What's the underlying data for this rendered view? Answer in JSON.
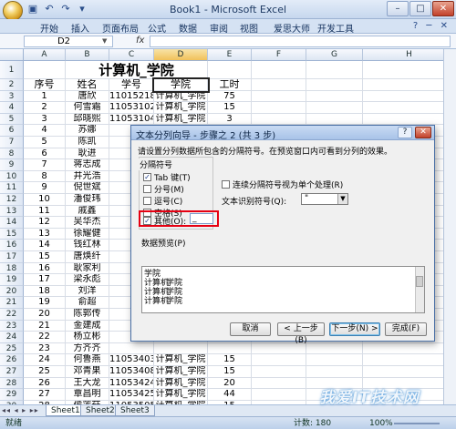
{
  "window": {
    "title": "Book1 - Microsoft Excel",
    "minimize": "–",
    "maximize": "□",
    "close": "✕"
  },
  "ribbon": {
    "tabs": [
      "开始",
      "插入",
      "页面布局",
      "公式",
      "数据",
      "审阅",
      "视图",
      "爱思大师",
      "开发工具"
    ],
    "right_icons": "? ─ ✕"
  },
  "formula_bar": {
    "name_box": "D2",
    "fx": "fx",
    "value": ""
  },
  "grid": {
    "columns": [
      "A",
      "B",
      "C",
      "D",
      "E",
      "F",
      "G",
      "H"
    ],
    "selected_column": "D",
    "rows": [
      {
        "n": "1",
        "cells": [
          "",
          "",
          "计算机_学院",
          "",
          "",
          "",
          "",
          ""
        ]
      },
      {
        "n": "2",
        "cells": [
          "序号",
          "姓名",
          "学号",
          "学院",
          "工时",
          "",
          "",
          ""
        ]
      },
      {
        "n": "3",
        "cells": [
          "1",
          "唐欣",
          "11015218",
          "计算机_学院",
          "75",
          "",
          "",
          ""
        ]
      },
      {
        "n": "4",
        "cells": [
          "2",
          "何雪霜",
          "11053102",
          "计算机_学院",
          "15",
          "",
          "",
          ""
        ]
      },
      {
        "n": "5",
        "cells": [
          "3",
          "邱晓熙",
          "11053104",
          "计算机_学院",
          "3",
          "",
          "",
          ""
        ]
      },
      {
        "n": "6",
        "cells": [
          "4",
          "苏娜",
          "",
          "",
          "",
          "",
          "",
          ""
        ]
      },
      {
        "n": "7",
        "cells": [
          "5",
          "陈凯",
          "",
          "",
          "",
          "",
          "",
          ""
        ]
      },
      {
        "n": "8",
        "cells": [
          "6",
          "耿进",
          "",
          "",
          "",
          "",
          "",
          ""
        ]
      },
      {
        "n": "9",
        "cells": [
          "7",
          "蒋志成",
          "",
          "",
          "",
          "",
          "",
          ""
        ]
      },
      {
        "n": "10",
        "cells": [
          "8",
          "井光浩",
          "",
          "",
          "",
          "",
          "",
          ""
        ]
      },
      {
        "n": "11",
        "cells": [
          "9",
          "倪世斌",
          "",
          "",
          "",
          "",
          "",
          ""
        ]
      },
      {
        "n": "12",
        "cells": [
          "10",
          "潘俊玮",
          "",
          "",
          "",
          "",
          "",
          ""
        ]
      },
      {
        "n": "13",
        "cells": [
          "11",
          "戚鑫",
          "",
          "",
          "",
          "",
          "",
          ""
        ]
      },
      {
        "n": "14",
        "cells": [
          "12",
          "吴华杰",
          "",
          "",
          "",
          "",
          "",
          ""
        ]
      },
      {
        "n": "15",
        "cells": [
          "13",
          "徐耀健",
          "",
          "",
          "",
          "",
          "",
          ""
        ]
      },
      {
        "n": "16",
        "cells": [
          "14",
          "钱红林",
          "",
          "",
          "",
          "",
          "",
          ""
        ]
      },
      {
        "n": "17",
        "cells": [
          "15",
          "唐焕纤",
          "",
          "",
          "",
          "",
          "",
          ""
        ]
      },
      {
        "n": "18",
        "cells": [
          "16",
          "耿家利",
          "",
          "",
          "",
          "",
          "",
          ""
        ]
      },
      {
        "n": "19",
        "cells": [
          "17",
          "梁永彪",
          "",
          "",
          "",
          "",
          "",
          ""
        ]
      },
      {
        "n": "20",
        "cells": [
          "18",
          "刘洋",
          "",
          "",
          "",
          "",
          "",
          ""
        ]
      },
      {
        "n": "21",
        "cells": [
          "19",
          "俞超",
          "",
          "",
          "",
          "",
          "",
          ""
        ]
      },
      {
        "n": "22",
        "cells": [
          "20",
          "陈郭传",
          "",
          "",
          "",
          "",
          "",
          ""
        ]
      },
      {
        "n": "23",
        "cells": [
          "21",
          "金建成",
          "",
          "",
          "",
          "",
          "",
          ""
        ]
      },
      {
        "n": "24",
        "cells": [
          "22",
          "杨立彬",
          "",
          "",
          "",
          "",
          "",
          ""
        ]
      },
      {
        "n": "25",
        "cells": [
          "23",
          "方齐齐",
          "",
          "",
          "",
          "",
          "",
          ""
        ]
      },
      {
        "n": "26",
        "cells": [
          "24",
          "何鲁燕",
          "11053403",
          "计算机_学院",
          "15",
          "",
          "",
          ""
        ]
      },
      {
        "n": "27",
        "cells": [
          "25",
          "邓青果",
          "11053408",
          "计算机_学院",
          "15",
          "",
          "",
          ""
        ]
      },
      {
        "n": "28",
        "cells": [
          "26",
          "王大龙",
          "11053424",
          "计算机_学院",
          "20",
          "",
          "",
          ""
        ]
      },
      {
        "n": "29",
        "cells": [
          "27",
          "覃昌明",
          "11053425",
          "计算机_学院",
          "44",
          "",
          "",
          ""
        ]
      },
      {
        "n": "30",
        "cells": [
          "28",
          "侯莲菇",
          "11053505",
          "计算机_学院",
          "15",
          "",
          "",
          ""
        ]
      }
    ]
  },
  "sheets": {
    "nav": "◂◂ ◂ ▸ ▸▸",
    "tabs": [
      "Sheet1",
      "Sheet2",
      "Sheet3"
    ],
    "active": 0
  },
  "status": {
    "mode": "就绪",
    "count": "计数: 180",
    "zoom": "100%"
  },
  "dialog": {
    "title": "文本分列向导 - 步骤之 2 (共 3 步)",
    "help": "?",
    "close": "✕",
    "description": "请设置分列数据所包含的分隔符号。在预览窗口内可看到分列的效果。",
    "group_label": "分隔符号",
    "delimiters": [
      {
        "label": "Tab 键(T)",
        "checked": true
      },
      {
        "label": "分号(M)",
        "checked": false
      },
      {
        "label": "逗号(C)",
        "checked": false
      },
      {
        "label": "空格(S)",
        "checked": false
      },
      {
        "label": "其他(O):",
        "checked": true
      }
    ],
    "other_value": "_",
    "consecutive_label": "连续分隔符号视为单个处理(R)",
    "qualifier_label": "文本识别符号(Q):",
    "qualifier_value": "\"",
    "preview_label": "数据预览(P)",
    "preview_col1": "学院\n计算机\n计算机\n计算机",
    "preview_col2": "\n学院\n学院\n学院",
    "buttons": {
      "cancel": "取消",
      "back": "< 上一步(B)",
      "next": "下一步(N) >",
      "finish": "完成(F)"
    }
  },
  "watermark": "我爱IT技术网"
}
